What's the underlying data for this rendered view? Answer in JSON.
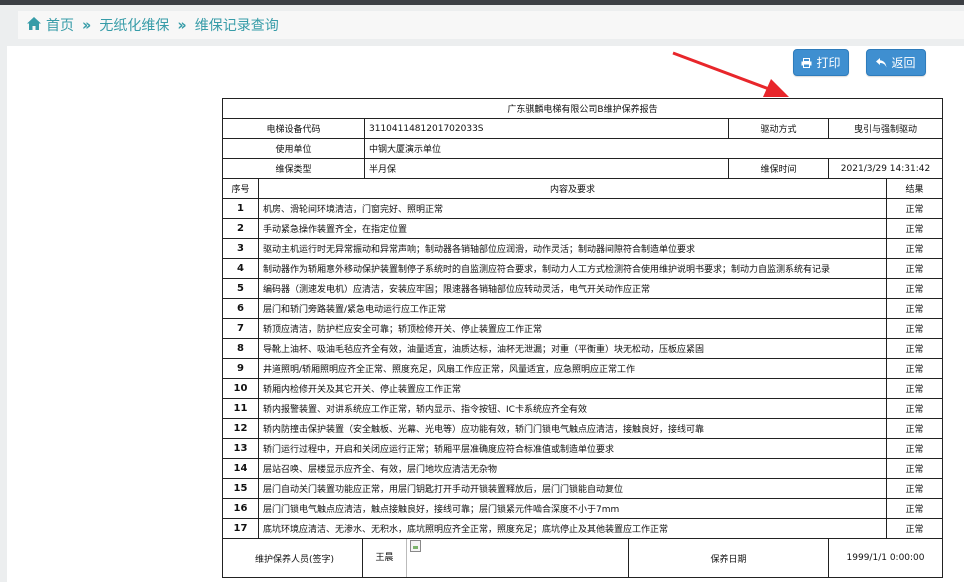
{
  "breadcrumb": {
    "home": "首页",
    "level2": "无纸化维保",
    "level3": "维保记录查询"
  },
  "toolbar": {
    "print_label": "打印",
    "back_label": "返回"
  },
  "report": {
    "title": "广东骐麟电梯有限公司B维护保养报告",
    "equip_code_label": "电梯设备代码",
    "equip_code": "3110411481201702033S",
    "drive_label": "驱动方式",
    "drive_value": "曳引与强制驱动",
    "user_unit_label": "使用单位",
    "user_unit": "中钢大厦演示单位",
    "maint_type_label": "维保类型",
    "maint_type": "半月保",
    "maint_time_label": "维保时间",
    "maint_time": "2021/3/29 14:31:42",
    "col_no": "序号",
    "col_content": "内容及要求",
    "col_result": "结果",
    "items": [
      {
        "no": "1",
        "content": "机房、滑轮间环境清洁，门窗完好、照明正常",
        "result": "正常"
      },
      {
        "no": "2",
        "content": "手动紧急操作装置齐全，在指定位置",
        "result": "正常"
      },
      {
        "no": "3",
        "content": "驱动主机运行时无异常振动和异常声响；制动器各销轴部位应润滑，动作灵活；制动器间隙符合制造单位要求",
        "result": "正常"
      },
      {
        "no": "4",
        "content": "制动器作为轿厢意外移动保护装置制停子系统时的自监测应符合要求，制动力人工方式检测符合使用维护说明书要求；制动力自监测系统有记录",
        "result": "正常"
      },
      {
        "no": "5",
        "content": "编码器（测速发电机）应清洁，安装应牢固；限速器各销轴部位应转动灵活，电气开关动作应正常",
        "result": "正常"
      },
      {
        "no": "6",
        "content": "层门和轿门旁路装置/紧急电动运行应工作正常",
        "result": "正常"
      },
      {
        "no": "7",
        "content": "轿顶应清洁，防护栏应安全可靠；轿顶检修开关、停止装置应工作正常",
        "result": "正常"
      },
      {
        "no": "8",
        "content": "导靴上油杯、吸油毛毡应齐全有效，油量适宜，油质达标，油杯无泄漏；对重（平衡重）块无松动，压板应紧固",
        "result": "正常"
      },
      {
        "no": "9",
        "content": "井道照明/轿厢照明应齐全正常、照度充足，风扇工作应正常，风量适宜，应急照明应正常工作",
        "result": "正常"
      },
      {
        "no": "10",
        "content": "轿厢内检修开关及其它开关、停止装置应工作正常",
        "result": "正常"
      },
      {
        "no": "11",
        "content": "轿内报警装置、对讲系统应工作正常，轿内显示、指令按钮、IC卡系统应齐全有效",
        "result": "正常"
      },
      {
        "no": "12",
        "content": "轿内防撞击保护装置（安全触板、光幕、光电等）应功能有效，轿门门锁电气触点应清洁，接触良好，接线可靠",
        "result": "正常"
      },
      {
        "no": "13",
        "content": "轿门运行过程中，开启和关闭应运行正常；轿厢平层准确度应符合标准值或制造单位要求",
        "result": "正常"
      },
      {
        "no": "14",
        "content": "层站召唤、层楼显示应齐全、有效，层门地坎应清洁无杂物",
        "result": "正常"
      },
      {
        "no": "15",
        "content": "层门自动关门装置功能应正常，用层门钥匙打开手动开锁装置释放后，层门门锁能自动复位",
        "result": "正常"
      },
      {
        "no": "16",
        "content": "层门门锁电气触点应清洁，触点接触良好，接线可靠；层门锁紧元件啮合深度不小于7mm",
        "result": "正常"
      },
      {
        "no": "17",
        "content": "底坑环境应清洁、无渗水、无积水，底坑照明应齐全正常，照度充足；底坑停止及其他装置应工作正常",
        "result": "正常"
      }
    ],
    "signer_label": "维护保养人员(签字)",
    "signer_name": "王晨",
    "date_label": "保养日期",
    "date_value": "1999/1/1 0:00:00"
  }
}
